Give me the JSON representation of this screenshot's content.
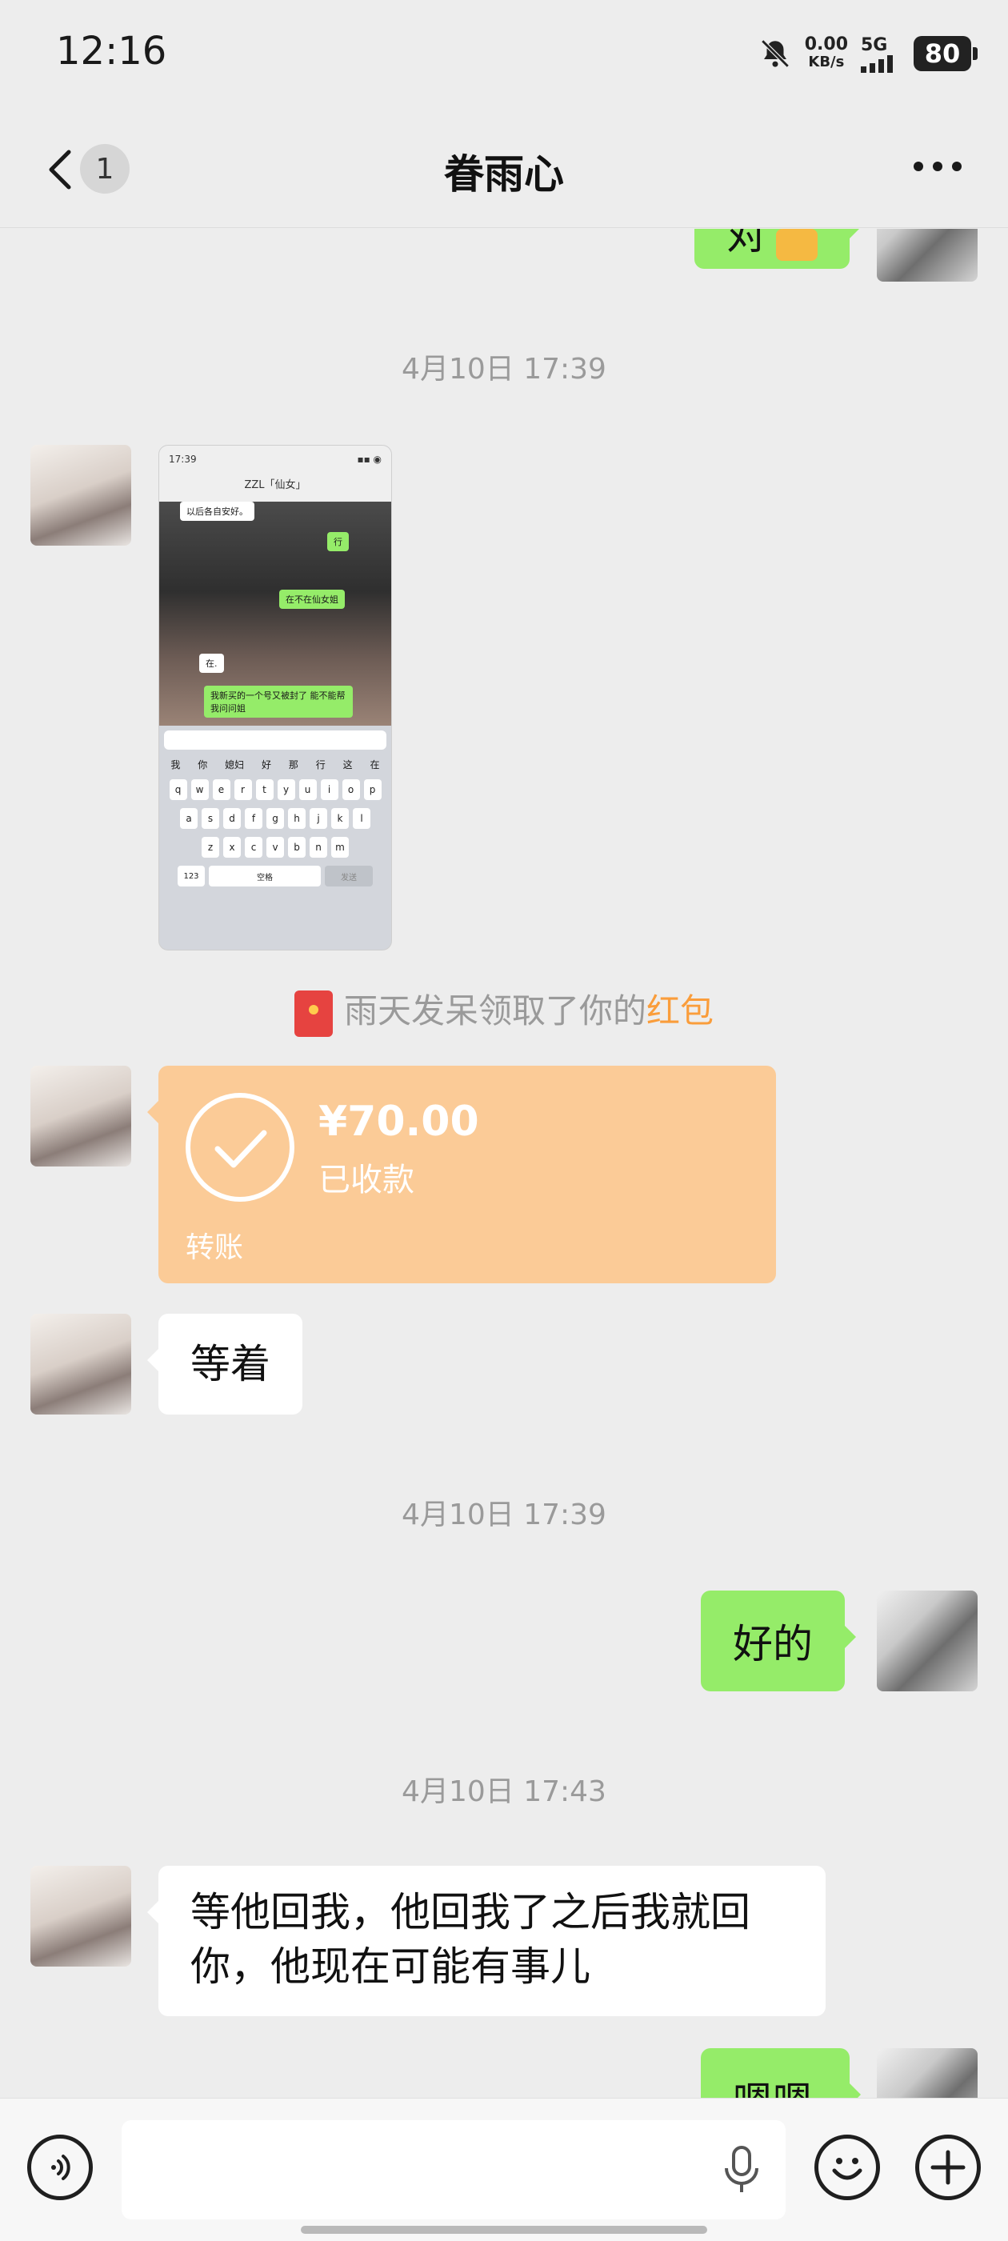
{
  "status_bar": {
    "time": "12:16",
    "net_speed_value": "0.00",
    "net_speed_unit": "KB/s",
    "signal": "5G",
    "battery": "80"
  },
  "nav": {
    "title": "眷雨心",
    "unread_count": "1",
    "icons": [
      "chevron-left-icon",
      "more-icon"
    ]
  },
  "messages": {
    "top_partial_text": "对",
    "timestamp_1": "4月10日 17:39",
    "screenshot_thumb": {
      "time": "17:39",
      "title": "ZZL「仙女」",
      "lines": [
        "以后各自安好。",
        "行",
        "在不在仙女姐",
        "在.",
        "我新买的一个号又被封了 能不能帮我问问姐"
      ],
      "keyboard_suggestions": [
        "我",
        "你",
        "媳妇",
        "好",
        "那",
        "行",
        "这",
        "在"
      ],
      "keyboard_rows": [
        [
          "q",
          "w",
          "e",
          "r",
          "t",
          "y",
          "u",
          "i",
          "o",
          "p"
        ],
        [
          "a",
          "s",
          "d",
          "f",
          "g",
          "h",
          "j",
          "k",
          "l"
        ],
        [
          "z",
          "x",
          "c",
          "v",
          "b",
          "n",
          "m"
        ]
      ],
      "space_label": "空格",
      "send_label": "发送",
      "num_label": "123"
    },
    "red_packet_notice": {
      "prefix": "雨天发呆领取了你的",
      "link": "红包"
    },
    "transfer": {
      "amount": "¥70.00",
      "status": "已收款",
      "label": "转账"
    },
    "text_1": "等着",
    "timestamp_2": "4月10日 17:39",
    "reply_1": "好的",
    "timestamp_3": "4月10日 17:43",
    "text_2_line1": "等他回我，他回我了之后我就回",
    "text_2_line2": "你，他现在可能有事儿",
    "bottom_partial_text": "嗯嗯"
  },
  "input_bar": {
    "icons": [
      "voice-icon",
      "microphone-icon",
      "emoji-icon",
      "plus-icon"
    ]
  }
}
